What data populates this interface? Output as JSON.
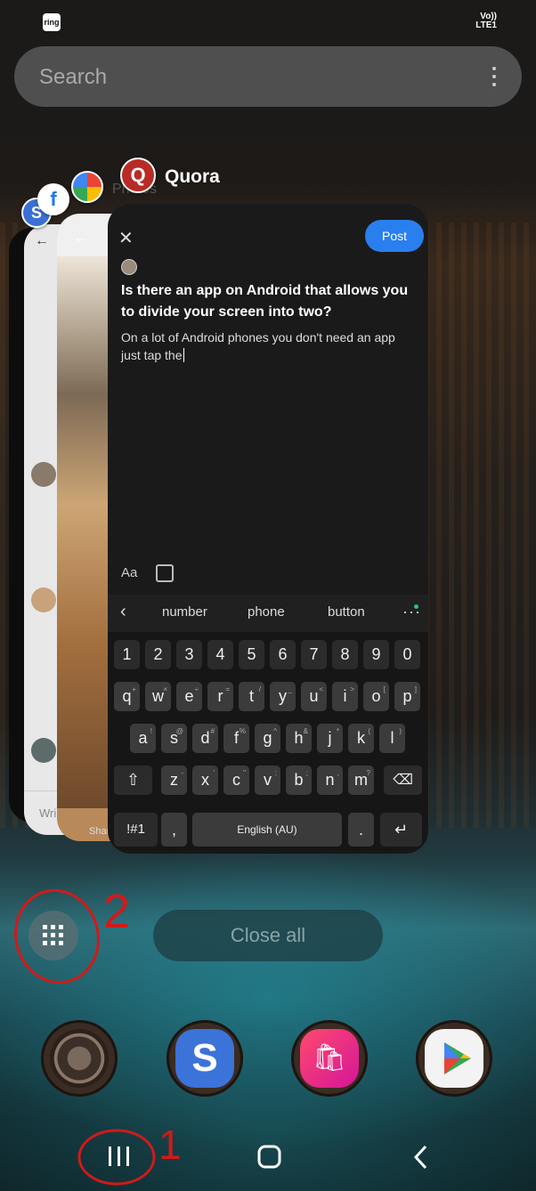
{
  "status": {
    "left_icon_label": "ring",
    "network_line1": "Vo))",
    "network_line2": "LTE1"
  },
  "search": {
    "placeholder": "Search"
  },
  "recent_apps": {
    "current_app": "Quora",
    "behind_app_label": "Photos",
    "app_icons": [
      "s-icon",
      "facebook-icon",
      "photos-icon",
      "quora-icon"
    ],
    "side_card_bottom_left": "Wri",
    "side_card_bottom_right": "Shar"
  },
  "quora": {
    "post_label": "Post",
    "question": "Is there an app on Android that allows you to divide your screen into two?",
    "answer": "On a lot of Android phones you don't need an app just tap the",
    "format_label": "Aa"
  },
  "keyboard": {
    "suggestions": [
      "number",
      "phone",
      "button"
    ],
    "row_numbers": [
      "1",
      "2",
      "3",
      "4",
      "5",
      "6",
      "7",
      "8",
      "9",
      "0"
    ],
    "row_q": [
      "q",
      "w",
      "e",
      "r",
      "t",
      "y",
      "u",
      "i",
      "o",
      "p"
    ],
    "row_q_hints": [
      "+",
      "×",
      "÷",
      "=",
      "/",
      "_",
      "<",
      ">",
      "[",
      "]"
    ],
    "row_a": [
      "a",
      "s",
      "d",
      "f",
      "g",
      "h",
      "j",
      "k",
      "l"
    ],
    "row_a_hints": [
      "!",
      "@",
      "#",
      "%",
      "^",
      "&",
      "*",
      "(",
      ")"
    ],
    "row_z": [
      "z",
      "x",
      "c",
      "v",
      "b",
      "n",
      "m"
    ],
    "row_z_hints": [
      "-",
      "'",
      "\"",
      ":",
      ";",
      ",",
      "?"
    ],
    "symbols_label": "!#1",
    "comma_label": ",",
    "space_label": "English (AU)",
    "period_label": "."
  },
  "controls": {
    "close_all_label": "Close all"
  },
  "annotations": {
    "label_one": "1",
    "label_two": "2"
  },
  "colors": {
    "post_blue": "#2a7fef",
    "accent_green": "#c6e85a",
    "annotation_red": "#d11a1a"
  }
}
